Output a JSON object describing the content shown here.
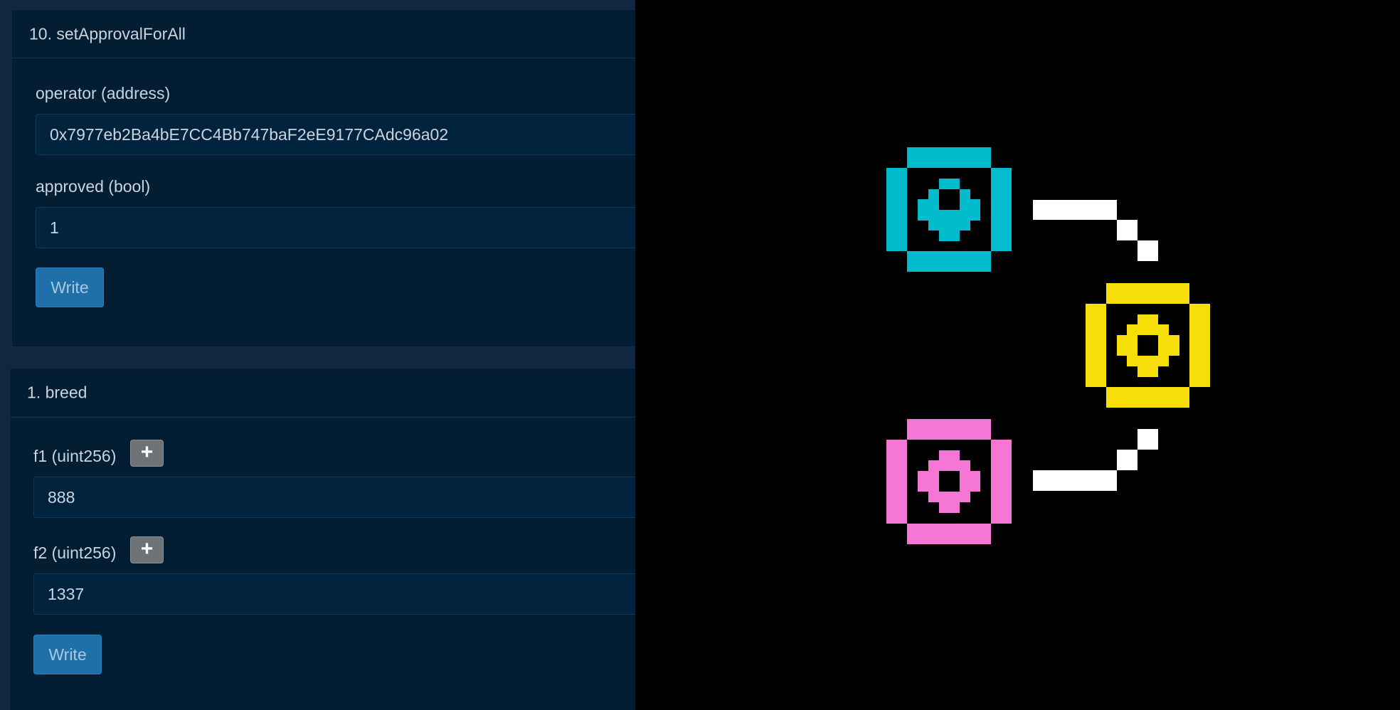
{
  "set_approval": {
    "title": "10. setApprovalForAll",
    "operator_label": "operator (address)",
    "operator_value": "0x7977eb2Ba4bE7CC4Bb747baF2eE9177CAdc96a02",
    "approved_label": "approved (bool)",
    "approved_value": "1",
    "write_label": "Write"
  },
  "breed": {
    "title": "1. breed",
    "f1_label": "f1 (uint256)",
    "f1_value": "888",
    "f2_label": "f2 (uint256)",
    "f2_value": "1337",
    "add_label": "+",
    "write_label": "Write"
  },
  "pixel_art": {
    "node_colors": {
      "top": "#00bccd",
      "middle": "#f6de08",
      "bottom": "#f576d4",
      "connector": "#ffffff"
    },
    "icon_names": [
      "cyan-pixel-node-icon",
      "yellow-pixel-node-icon",
      "pink-pixel-node-icon"
    ]
  },
  "colors": {
    "panel_bg": "#122541",
    "card_bg": "#031e33",
    "input_bg": "#02233d",
    "write_button": "#1f6fa8",
    "add_button": "#6e7378",
    "text": "#c9d4df"
  }
}
